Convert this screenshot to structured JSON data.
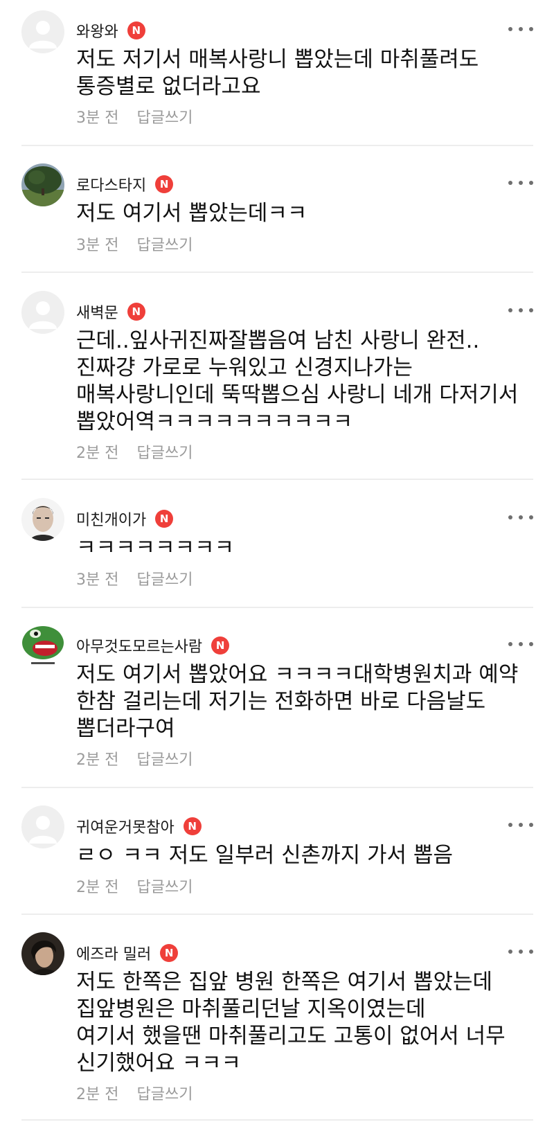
{
  "comments": [
    {
      "username": "와왕와",
      "badge": "N",
      "avatar": "default-avatar",
      "text": "저도 저기서 매복사랑니 뽑았는데 마취풀려도 통증별로 없더라고요",
      "time": "3분 전",
      "reply": "답글쓰기"
    },
    {
      "username": "로다스타지",
      "badge": "N",
      "avatar": "tree-field-photo",
      "text": "저도 여기서 뽑았는데ㅋㅋ",
      "time": "3분 전",
      "reply": "답글쓰기"
    },
    {
      "username": "새벽문",
      "badge": "N",
      "avatar": "default-avatar",
      "text": "근데..잎사귀진짜잘뽑음여 남친 사랑니 완전..진짜걍 가로로 누워있고 신경지나가는 매복사랑니인데 뚝딱뽑으심 사랑니 네개 다저기서 뽑았어역ㅋㅋㅋㅋㅋㅋㅋㅋㅋㅋ",
      "time": "2분 전",
      "reply": "답글쓰기"
    },
    {
      "username": "미친개이가",
      "badge": "N",
      "avatar": "man-face-photo",
      "text": "ㅋㅋㅋㅋㅋㅋㅋㅋ",
      "time": "3분 전",
      "reply": "답글쓰기"
    },
    {
      "username": "아무것도모르는사람",
      "badge": "N",
      "avatar": "frog-cartoon",
      "text": "저도 여기서 뽑았어요 ㅋㅋㅋㅋ대학병원치과 예약 한참 걸리는데 저기는 전화하면 바로 다음날도 뽑더라구여",
      "time": "2분 전",
      "reply": "답글쓰기"
    },
    {
      "username": "귀여운거못참아",
      "badge": "N",
      "avatar": "default-avatar",
      "text": "ㄹㅇ ㅋㅋ 저도 일부러 신촌까지 가서 뽑음",
      "time": "2분 전",
      "reply": "답글쓰기"
    },
    {
      "username": "에즈라 밀러",
      "badge": "N",
      "avatar": "person-portrait-photo",
      "text": "저도 한쪽은 집앞 병원 한쪽은 여기서 뽑았는데\n집앞병원은 마취풀리던날 지옥이였는데\n여기서 했을땐 마취풀리고도 고통이 없어서 너무 신기했어요 ㅋㅋㅋ",
      "time": "2분 전",
      "reply": "답글쓰기"
    }
  ]
}
